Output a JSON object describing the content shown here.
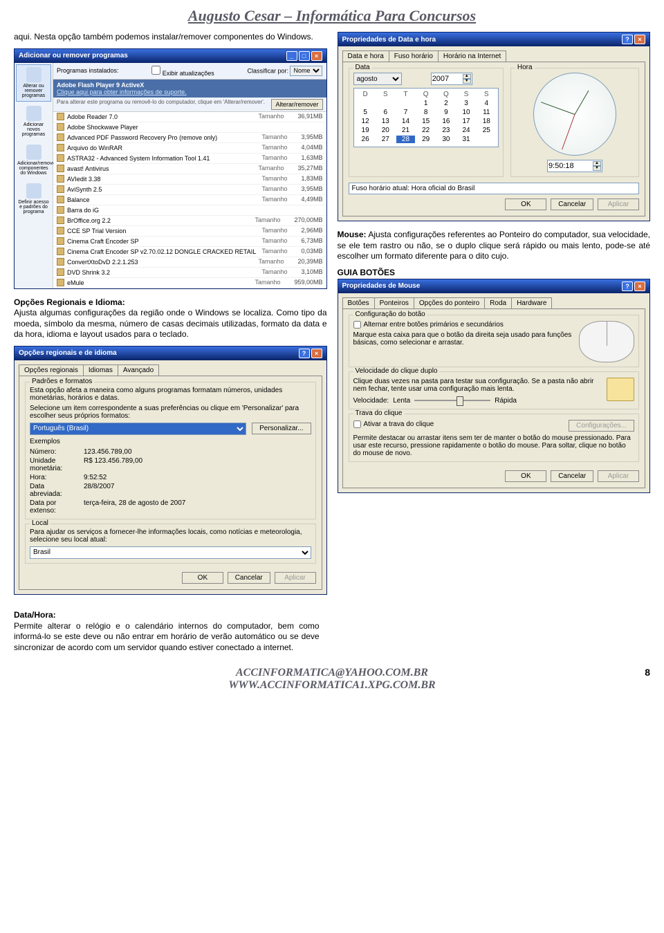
{
  "header": {
    "title": "Augusto Cesar – Informática Para Concursos"
  },
  "intro": {
    "p1": "aqui. Nesta opção também podemos instalar/remover componentes do Windows.",
    "opc_head": "Opções Regionais e Idioma:",
    "opc_body": "Ajusta algumas configurações da região onde o Windows se localiza. Como tipo da moeda, símbolo da mesma, número de casas decimais utilizadas, formato da data e da hora, idioma e layout usados para o teclado.",
    "mouse_lbl": "Mouse:",
    "mouse_body": " Ajusta configurações referentes ao Ponteiro do computador, sua velocidade, se ele tem rastro ou não, se o duplo clique será rápido ou mais lento, pode-se até escolher um formato diferente para o dito cujo.",
    "guia": "GUIA BOTÕES",
    "data_head": "Data/Hora:",
    "data_body": "Permite alterar o relógio e o calendário internos do computador, bem como informá-lo se este deve ou não entrar em horário de verão automático ou se deve sincronizar de acordo com um servidor quando estiver conectado a internet."
  },
  "addremove": {
    "title": "Adicionar ou remover programas",
    "side": [
      "Alterar ou remover programas",
      "Adicionar novos programas",
      "Adicionar/remover componentes do Windows",
      "Definir acesso e padrões do programa"
    ],
    "installed": "Programas instalados:",
    "hide": "Exibir atualizações",
    "sort": "Classificar por:",
    "sort_val": "Nome",
    "hl_name": "Adobe Flash Player 9 ActiveX",
    "hl_link": "Clique aqui para obter informações de suporte.",
    "sub": "Para alterar este programa ou removê-lo do computador, clique em 'Alterar/remover'.",
    "sub_btn": "Alterar/remover",
    "tamanho": "Tamanho",
    "items": [
      {
        "n": "Adobe Reader 7.0",
        "s": "36,91MB"
      },
      {
        "n": "Adobe Shockwave Player",
        "s": ""
      },
      {
        "n": "Advanced PDF Password Recovery Pro (remove only)",
        "s": "3,95MB"
      },
      {
        "n": "Arquivo do WinRAR",
        "s": "4,04MB"
      },
      {
        "n": "ASTRA32 - Advanced System Information Tool 1.41",
        "s": "1,63MB"
      },
      {
        "n": "avast! Antivirus",
        "s": "35,27MB"
      },
      {
        "n": "AVIedit 3.38",
        "s": "1,83MB"
      },
      {
        "n": "AviSynth 2.5",
        "s": "3,95MB"
      },
      {
        "n": "Balance",
        "s": "4,49MB"
      },
      {
        "n": "Barra do iG",
        "s": ""
      },
      {
        "n": "BrOffice.org 2.2",
        "s": "270,00MB"
      },
      {
        "n": "CCE SP Trial Version",
        "s": "2,96MB"
      },
      {
        "n": "Cinema Craft Encoder SP",
        "s": "6,73MB"
      },
      {
        "n": "Cinema Craft Encoder SP v2.70.02.12 DONGLE CRACKED RETAIL",
        "s": "0,03MB"
      },
      {
        "n": "ConvertXtoDvD 2.2.1.253",
        "s": "20,39MB"
      },
      {
        "n": "DVD Shrink 3.2",
        "s": "3,10MB"
      },
      {
        "n": "eMule",
        "s": "959,00MB"
      }
    ]
  },
  "datetime": {
    "title": "Propriedades de Data e hora",
    "tabs": [
      "Data e hora",
      "Fuso horário",
      "Horário na Internet"
    ],
    "data_lbl": "Data",
    "hora_lbl": "Hora",
    "month": "agosto",
    "year": "2007",
    "days": [
      "D",
      "S",
      "T",
      "Q",
      "Q",
      "S",
      "S"
    ],
    "grid": [
      "",
      "",
      "",
      "1",
      "2",
      "3",
      "4",
      "5",
      "6",
      "7",
      "8",
      "9",
      "10",
      "11",
      "12",
      "13",
      "14",
      "15",
      "16",
      "17",
      "18",
      "19",
      "20",
      "21",
      "22",
      "23",
      "24",
      "25",
      "26",
      "27",
      "28",
      "29",
      "30",
      "31",
      "",
      "",
      "",
      "",
      "",
      "",
      "",
      ""
    ],
    "sel_day": "28",
    "time": "9:50:18",
    "tz_lbl": "Fuso horário atual:",
    "tz_val": "Hora oficial do Brasil",
    "ok": "OK",
    "cancel": "Cancelar",
    "apply": "Aplicar"
  },
  "regional": {
    "title": "Opções regionais e de idioma",
    "tabs": [
      "Opções regionais",
      "Idiomas",
      "Avançado"
    ],
    "grp1": "Padrões e formatos",
    "p1": "Esta opção afeta a maneira como alguns programas formatam números, unidades monetárias, horários e datas.",
    "p2": "Selecione um item correspondente a suas preferências ou clique em 'Personalizar' para escolher seus próprios formatos:",
    "lang": "Português (Brasil)",
    "cust": "Personalizar...",
    "ex_lbl": "Exemplos",
    "ex": {
      "numero_l": "Número:",
      "numero_v": "123.456.789,00",
      "moeda_l": "Unidade monetária:",
      "moeda_v": "R$ 123.456.789,00",
      "hora_l": "Hora:",
      "hora_v": "9:52:52",
      "data_l": "Data abreviada:",
      "data_v": "28/8/2007",
      "ext_l": "Data por extenso:",
      "ext_v": "terça-feira, 28 de agosto de 2007"
    },
    "grp2": "Local",
    "p3": "Para ajudar os serviços a fornecer-lhe informações locais, como notícias e meteorologia, selecione seu local atual:",
    "loc": "Brasil"
  },
  "mouse": {
    "title": "Propriedades de Mouse",
    "tabs": [
      "Botões",
      "Ponteiros",
      "Opções do ponteiro",
      "Roda",
      "Hardware"
    ],
    "g1": "Configuração do botão",
    "chk1": "Alternar entre botões primários e secundários",
    "p1": "Marque esta caixa para que o botão da direita seja usado para funções básicas, como selecionar e arrastar.",
    "g2": "Velocidade do clique duplo",
    "p2": "Clique duas vezes na pasta para testar sua configuração. Se a pasta não abrir nem fechar, tente usar uma configuração mais lenta.",
    "vel": "Velocidade:",
    "lenta": "Lenta",
    "rap": "Rápida",
    "g3": "Trava do clique",
    "chk3": "Ativar a trava do clique",
    "cfg": "Configurações...",
    "p3": "Permite destacar ou arrastar itens sem ter de manter o botão do mouse pressionado. Para usar este recurso, pressione rapidamente o botão do mouse. Para soltar, clique no botão do mouse de novo."
  },
  "footer": {
    "l1": "ACCINFORMATICA@YAHOO.COM.BR",
    "l2": "WWW.ACCINFORMATICA1.XPG.COM.BR",
    "page": "8"
  }
}
